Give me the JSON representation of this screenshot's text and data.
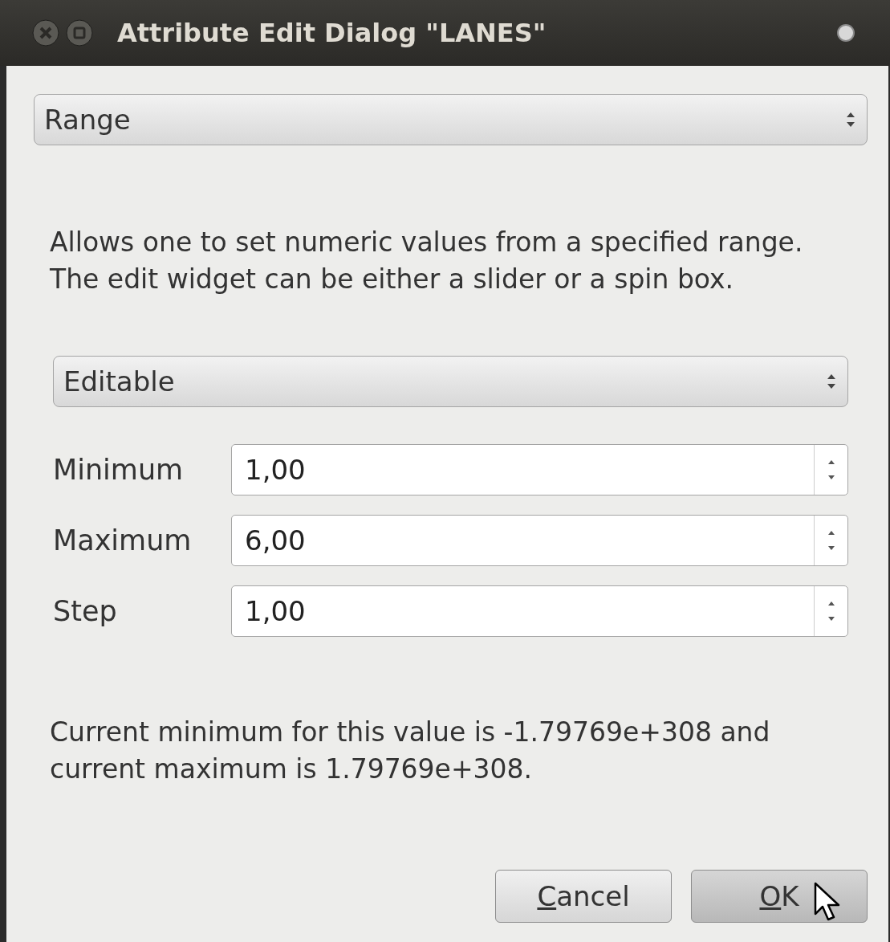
{
  "window": {
    "title": "Attribute Edit Dialog \"LANES\""
  },
  "edit_type": {
    "value": "Range"
  },
  "description": "Allows one to set numeric values from a specified range. The edit widget can be either a slider or a spin box.",
  "widget_mode": {
    "value": "Editable"
  },
  "fields": [
    {
      "label": "Minimum",
      "value": "1,00"
    },
    {
      "label": "Maximum",
      "value": "6,00"
    },
    {
      "label": "Step",
      "value": "1,00"
    }
  ],
  "note": "Current minimum for this value is -1.79769e+308 and current maximum is 1.79769e+308.",
  "buttons": [
    {
      "label": "Cancel",
      "hovered": false,
      "mnemonic_underlined": true
    },
    {
      "label": "OK",
      "hovered": true,
      "mnemonic_underlined": true
    }
  ]
}
